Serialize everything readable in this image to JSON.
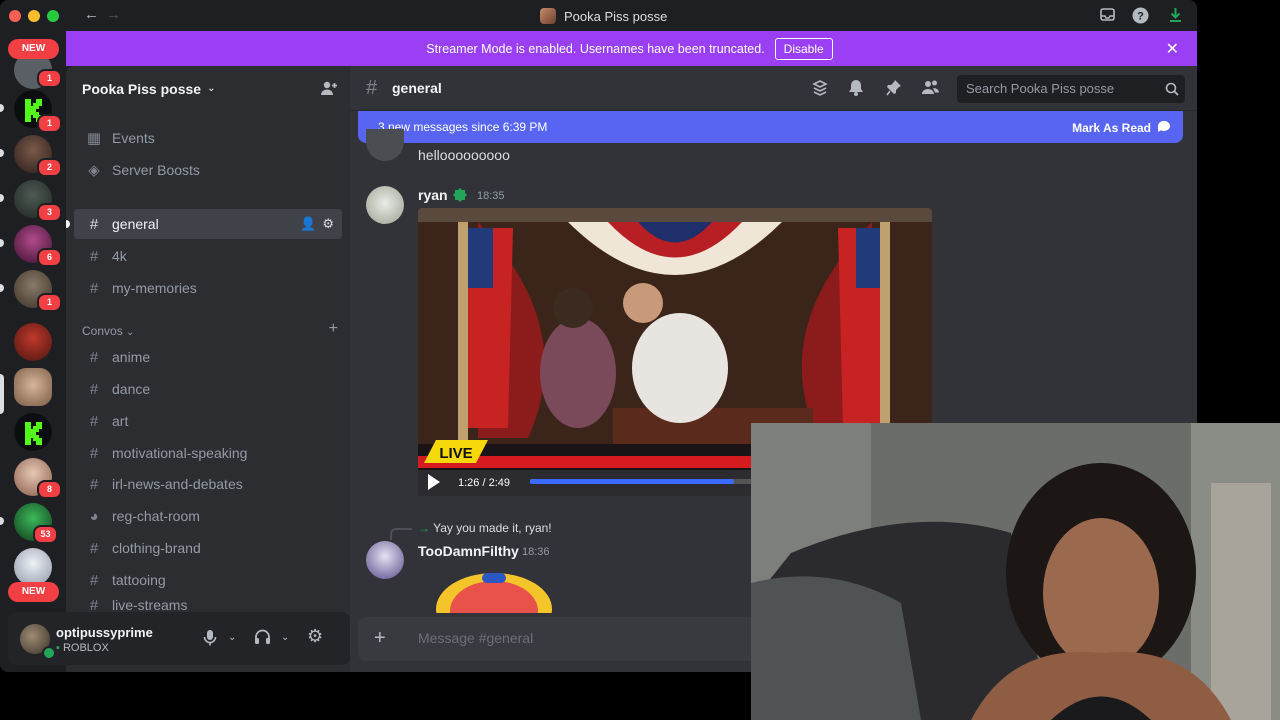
{
  "window": {
    "title": "Pooka Piss posse"
  },
  "banner": {
    "text": "Streamer Mode is enabled. Usernames have been truncated.",
    "button": "Disable"
  },
  "rail": {
    "new_top": "NEW",
    "new_bottom": "NEW",
    "badges": [
      "1",
      "1",
      "2",
      "3",
      "6",
      "1",
      "8",
      "53"
    ]
  },
  "server": {
    "name": "Pooka Piss posse",
    "top_items": [
      {
        "label": "Events",
        "icon": "calendar-icon"
      },
      {
        "label": "Server Boosts",
        "icon": "boost-icon"
      }
    ],
    "channels": [
      "general",
      "4k",
      "my-memories"
    ],
    "category": "Convos",
    "convos": [
      "anime",
      "dance",
      "art",
      "motivational-speaking",
      "irl-news-and-debates",
      "reg-chat-room",
      "clothing-brand",
      "tattooing",
      "live-streams"
    ],
    "active_channel": "general"
  },
  "user": {
    "name": "optipussyprime",
    "status": "ROBLOX"
  },
  "chat": {
    "channel": "general",
    "search_placeholder": "Search Pooka Piss posse",
    "new_messages": "3 new messages since 6:39 PM",
    "mark_read": "Mark As Read",
    "messages": [
      {
        "text": "hellooooooooo"
      },
      {
        "author": "ryan",
        "time": "18:35"
      },
      {
        "reply": "Yay you made it, ryan!",
        "author": "TooDamnFilthy",
        "time": "18:36"
      }
    ],
    "video": {
      "live": "LIVE",
      "time": "1:26 / 2:49",
      "progress": 0.52
    },
    "composer_placeholder": "Message #general"
  },
  "colors": {
    "accent": "#5865f2",
    "banner": "#9b3ff5",
    "badge": "#f23f43",
    "online": "#23a559"
  }
}
